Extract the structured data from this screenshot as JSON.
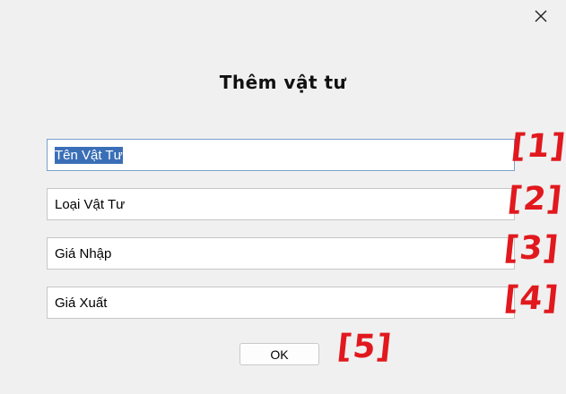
{
  "dialog": {
    "title": "Thêm vật tư",
    "close_icon": "close-icon"
  },
  "fields": [
    {
      "label": "Tên Vật Tư",
      "selected": true,
      "focused": true
    },
    {
      "label": "Loại Vật Tư"
    },
    {
      "label": "Giá Nhập"
    },
    {
      "label": "Giá Xuất"
    }
  ],
  "buttons": {
    "ok_label": "OK"
  },
  "annotations": [
    "[1]",
    "[2]",
    "[3]",
    "[4]",
    "[5]"
  ],
  "colors": {
    "background": "#f0f0f0",
    "annotation": "#e1191e",
    "selection": "#3a6fb7",
    "focus_border": "#7aa1cc"
  }
}
